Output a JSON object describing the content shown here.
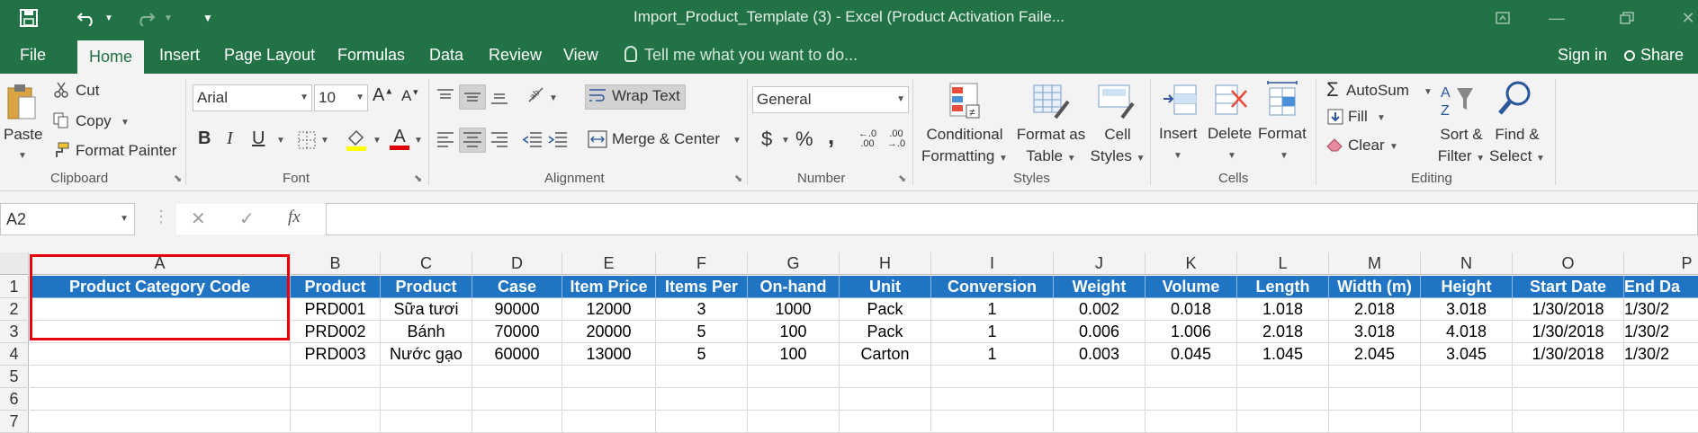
{
  "window": {
    "title": "Import_Product_Template (3) - Excel (Product Activation Faile...",
    "accent": "#217346"
  },
  "tabs": [
    "File",
    "Home",
    "Insert",
    "Page Layout",
    "Formulas",
    "Data",
    "Review",
    "View"
  ],
  "active_tab": "Home",
  "tellme": "Tell me what you want to do...",
  "account": {
    "signin": "Sign in",
    "share": "Share"
  },
  "ribbon": {
    "clipboard": {
      "label": "Clipboard",
      "paste": "Paste",
      "cut": "Cut",
      "copy": "Copy",
      "format_painter": "Format Painter"
    },
    "font": {
      "label": "Font",
      "name": "Arial",
      "size": "10",
      "bold": "B",
      "italic": "I",
      "underline": "U"
    },
    "alignment": {
      "label": "Alignment",
      "wrap": "Wrap Text",
      "merge": "Merge & Center"
    },
    "number": {
      "label": "Number",
      "format": "General",
      "currency": "$",
      "percent": "%",
      "comma": ","
    },
    "styles": {
      "label": "Styles",
      "conditional": [
        "Conditional",
        "Formatting"
      ],
      "format_table": [
        "Format as",
        "Table"
      ],
      "cell_styles": [
        "Cell",
        "Styles"
      ]
    },
    "cells": {
      "label": "Cells",
      "insert": "Insert",
      "delete": "Delete",
      "format": "Format"
    },
    "editing": {
      "label": "Editing",
      "autosum": "AutoSum",
      "fill": "Fill",
      "clear": "Clear",
      "sort": [
        "Sort &",
        "Filter"
      ],
      "find": [
        "Find &",
        "Select"
      ]
    }
  },
  "formula_bar": {
    "name_box": "A2",
    "fx": "fx",
    "formula": ""
  },
  "sheet": {
    "columns": [
      "A",
      "B",
      "C",
      "D",
      "E",
      "F",
      "G",
      "H",
      "I",
      "J",
      "K",
      "L",
      "M",
      "N",
      "O",
      "P"
    ],
    "rows": [
      "1",
      "2",
      "3",
      "4",
      "5",
      "6",
      "7"
    ],
    "header_row": [
      "Product Category Code",
      "Product",
      "Product",
      "Case",
      "Item Price",
      "Items Per",
      "On-hand",
      "Unit",
      "Conversion",
      "Weight",
      "Volume",
      "Length",
      "Width (m)",
      "Height",
      "Start Date",
      "End Da"
    ],
    "data_rows": [
      [
        "",
        "PRD001",
        "Sữa tươi",
        "90000",
        "12000",
        "3",
        "1000",
        "Pack",
        "1",
        "0.002",
        "0.018",
        "1.018",
        "2.018",
        "3.018",
        "1/30/2018",
        "1/30/2"
      ],
      [
        "",
        "PRD002",
        "Bánh",
        "70000",
        "20000",
        "5",
        "100",
        "Pack",
        "1",
        "0.006",
        "1.006",
        "2.018",
        "3.018",
        "4.018",
        "1/30/2018",
        "1/30/2"
      ],
      [
        "",
        "PRD003",
        "Nước gạo",
        "60000",
        "13000",
        "5",
        "100",
        "Carton",
        "1",
        "0.003",
        "0.045",
        "1.045",
        "2.045",
        "3.045",
        "1/30/2018",
        "1/30/2"
      ]
    ],
    "header_fill": "#1f74c3",
    "highlight_color": "#e8000d"
  }
}
